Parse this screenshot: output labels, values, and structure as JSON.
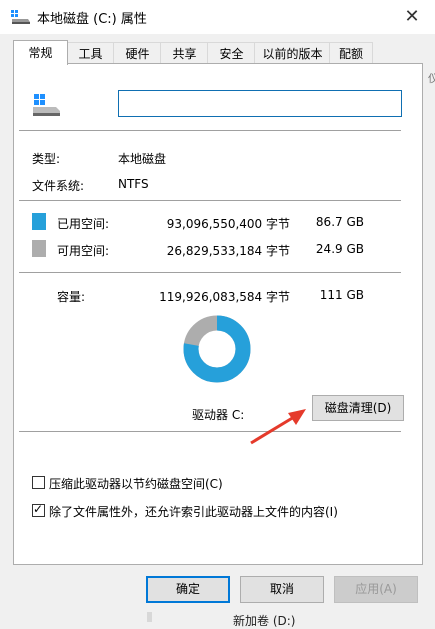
{
  "window": {
    "title": "本地磁盘 (C:) 属性",
    "close_glyph": "✕"
  },
  "tabs": [
    {
      "label": "常规",
      "active": true
    },
    {
      "label": "工具"
    },
    {
      "label": "硬件"
    },
    {
      "label": "共享"
    },
    {
      "label": "安全"
    },
    {
      "label": "以前的版本"
    },
    {
      "label": "配额"
    }
  ],
  "general": {
    "name_value": "",
    "type_label": "类型:",
    "type_value": "本地磁盘",
    "fs_label": "文件系统:",
    "fs_value": "NTFS",
    "used": {
      "label": "已用空间:",
      "bytes": "93,096,550,400 字节",
      "human": "86.7 GB",
      "color": "#26a0da"
    },
    "free": {
      "label": "可用空间:",
      "bytes": "26,829,533,184 字节",
      "human": "24.9 GB",
      "color": "#adadad"
    },
    "capacity": {
      "label": "容量:",
      "bytes": "119,926,083,584 字节",
      "human": "111 GB"
    },
    "used_fraction": 0.776,
    "drive_label": "驱动器 C:",
    "cleanup_button": "磁盘清理(D)",
    "compress_label": "压缩此驱动器以节约磁盘空间(C)",
    "compress_checked": false,
    "index_label": "除了文件属性外，还允许索引此驱动器上文件的内容(I)",
    "index_checked": true,
    "check_glyph": "✓"
  },
  "buttons": {
    "ok": "确定",
    "cancel": "取消",
    "apply": "应用(A)"
  },
  "background": {
    "right_edge_text": "仪",
    "bottom_text": "新加卷 (D:)"
  },
  "icons": [
    "drive-icon",
    "close-icon",
    "check-icon",
    "arrow-annotation"
  ]
}
